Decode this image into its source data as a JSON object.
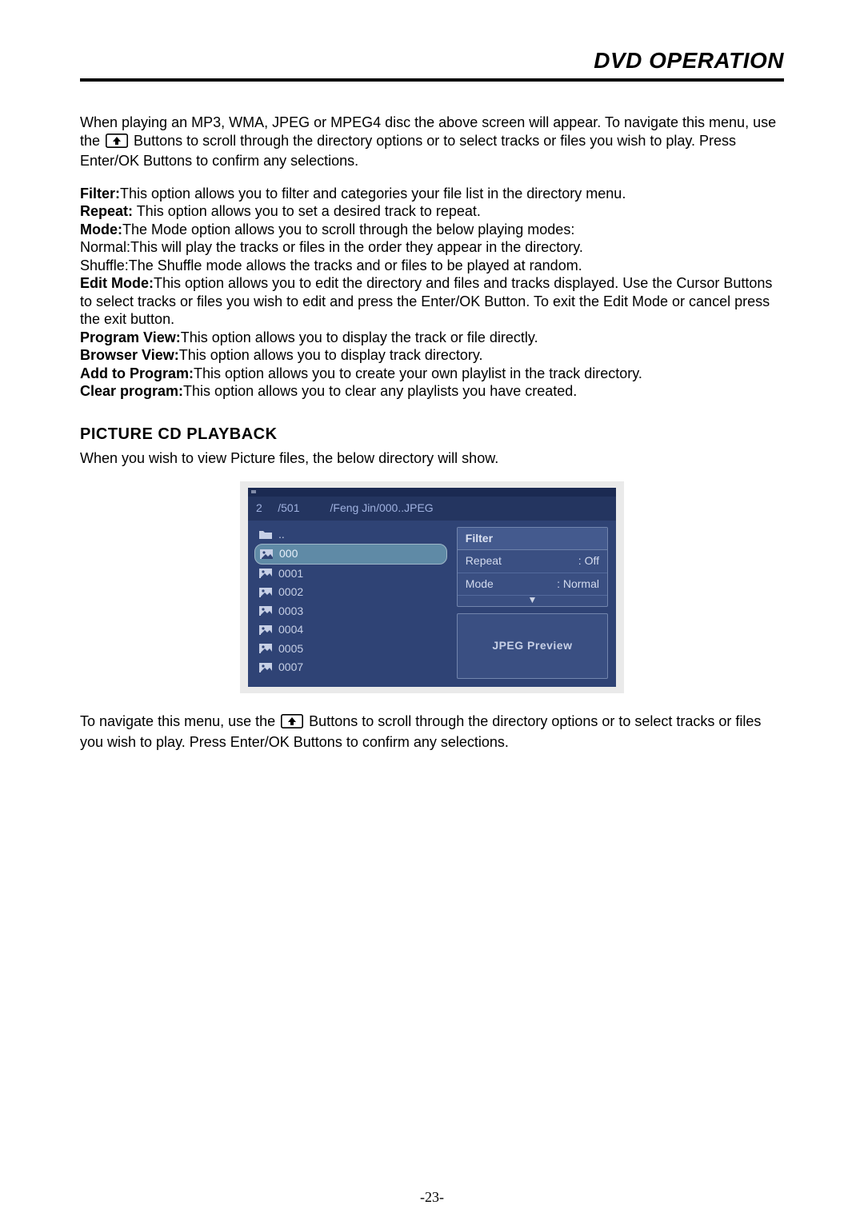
{
  "header": {
    "title": "DVD OPERATION"
  },
  "intro": {
    "p1a": "When playing an MP3, WMA, JPEG or MPEG4 disc the above screen will appear. To navigate this menu, use the ",
    "p1b": " Buttons to scroll through the directory options or to select tracks or files you wish to play. Press Enter/OK Buttons to confirm any selections."
  },
  "terms": [
    {
      "label": "Filter:",
      "text": "This option allows you to filter and categories your file list in the directory menu."
    },
    {
      "label": "Repeat:",
      "text": " This option allows you to set a desired track to repeat."
    },
    {
      "label": "Mode:",
      "text": "The Mode option allows you to scroll through the below playing modes:"
    },
    {
      "label": "",
      "text": "Normal:This will play the tracks or files in the order they appear in the directory."
    },
    {
      "label": "",
      "text": "Shuffle:The Shuffle mode allows the tracks and or files to be played at random."
    },
    {
      "label": "Edit Mode:",
      "text": "This option allows you to edit the directory and files and tracks displayed. Use the Cursor Buttons to select tracks or files you wish to edit and press the Enter/OK Button. To exit the Edit Mode or cancel press the exit button."
    },
    {
      "label": "Program View:",
      "text": "This option allows you to display the track or file directly."
    },
    {
      "label": "Browser View:",
      "text": "This option allows you to display track directory."
    },
    {
      "label": "Add to Program:",
      "text": "This option allows you to create your own playlist in the track directory."
    },
    {
      "label": "Clear program:",
      "text": "This option allows you to clear any playlists you have created."
    }
  ],
  "section": {
    "heading": "PICTURE CD PLAYBACK",
    "sub": "When you wish to view Picture files, the below directory will show."
  },
  "screenshot": {
    "crumb_index": "2",
    "crumb_total": "/501",
    "crumb_path": "/Feng Jin/000..JPEG",
    "left_items": [
      {
        "label": "..",
        "type": "up",
        "selected": false
      },
      {
        "label": "000",
        "type": "img",
        "selected": true
      },
      {
        "label": "0001",
        "type": "img",
        "selected": false
      },
      {
        "label": "0002",
        "type": "img",
        "selected": false
      },
      {
        "label": "0003",
        "type": "img",
        "selected": false
      },
      {
        "label": "0004",
        "type": "img",
        "selected": false
      },
      {
        "label": "0005",
        "type": "img",
        "selected": false
      },
      {
        "label": "0007",
        "type": "img",
        "selected": false
      }
    ],
    "panel_title": "Filter",
    "panel_rows": [
      {
        "k": "Repeat",
        "v": ": Off"
      },
      {
        "k": "Mode",
        "v": ": Normal"
      }
    ],
    "preview_label": "JPEG Preview"
  },
  "after": {
    "a": "To navigate this menu, use the ",
    "b": " Buttons to scroll through the directory options or to select tracks or files you wish to play. Press Enter/OK Buttons to confirm any selections."
  },
  "page_number": "-23-"
}
